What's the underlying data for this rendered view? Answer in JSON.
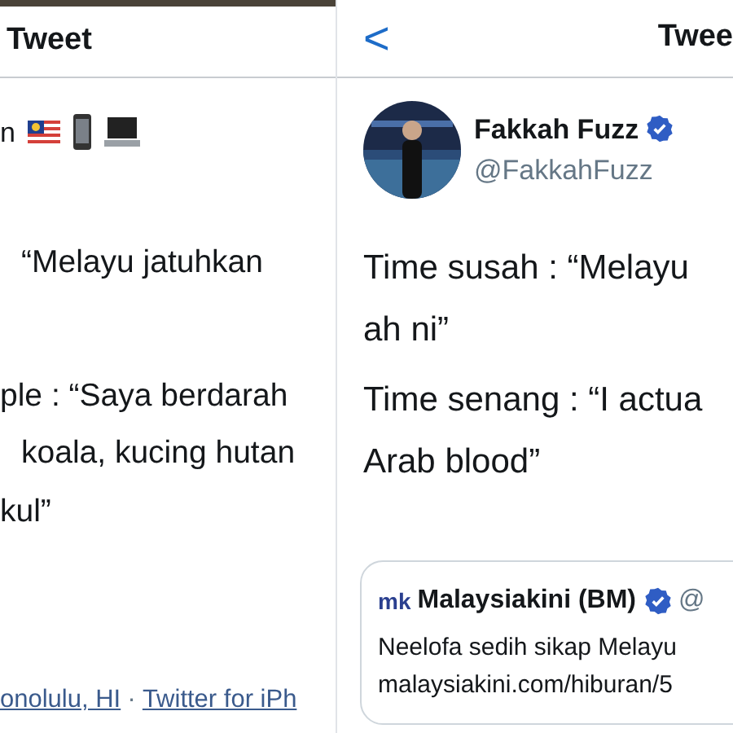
{
  "left_panel": {
    "header": {
      "title": "Tweet"
    },
    "author_line": {
      "text": "n"
    },
    "text_lines": [
      {
        "text": "“Melayu jatuhkan"
      },
      {
        "text": "ple : “Saya berdarah"
      },
      {
        "text": "koala, kucing hutan"
      },
      {
        "text": "kul”"
      }
    ],
    "footer": {
      "location": "onolulu, HI",
      "separator": "·",
      "source": "Twitter for iPh"
    }
  },
  "right_panel": {
    "header": {
      "back": "<",
      "title": "Twee"
    },
    "author": {
      "name": "Fakkah Fuzz",
      "handle": "@FakkahFuzz",
      "verified": true
    },
    "paragraphs": [
      [
        "Time susah : “Melayu",
        "ah ni”"
      ],
      [
        "Time senang : “I actua",
        "Arab blood”"
      ]
    ],
    "quoted_tweet": {
      "logo": "mk",
      "name": "Malaysiakini (BM)",
      "verified": true,
      "handle": "@",
      "text": "Neelofa sedih sikap Melayu",
      "link": "malaysiakini.com/hiburan/5"
    }
  }
}
